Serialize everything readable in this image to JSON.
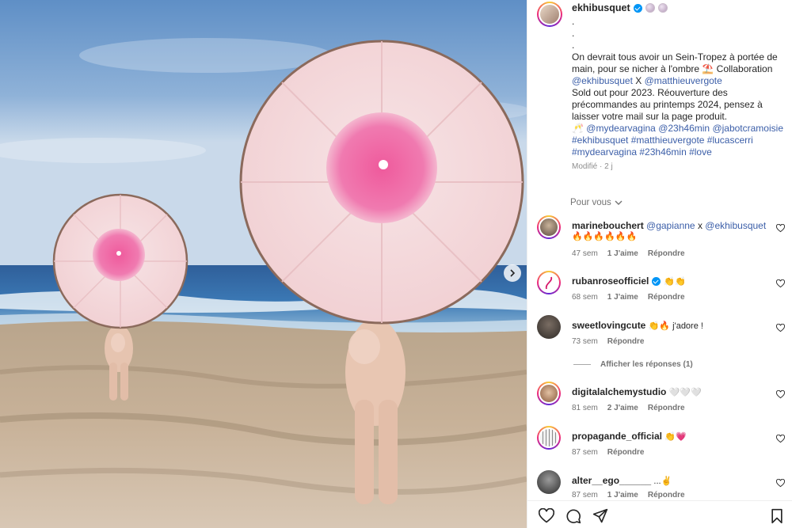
{
  "author": {
    "username": "ekhibusquet"
  },
  "caption": {
    "dots": [
      ".",
      ".",
      "."
    ],
    "line1": "On devrait tous avoir un Sein-Tropez à portée de main, pour se nicher à l'ombre",
    "emoji_umbrella": "⛱️",
    "line1b": " Collaboration",
    "mention1": "@ekhibusquet",
    "x": " X ",
    "mention2": "@matthieuvergote",
    "line2": "Sold out pour 2023. Réouverture des précommandes au printemps 2024, pensez à laisser votre mail sur la page produit.",
    "emoji_champagne": "🥂",
    "mention3": "@mydearvagina",
    "mention4": "@23h46min",
    "mention5": "@jabotcramoisie",
    "hashtags": "#ekhibusquet #matthieuvergote #lucascerri #mydearvagina #23h46min #love",
    "edited": "Modifié · 2 j"
  },
  "pour_vous": "Pour vous",
  "comments": [
    {
      "user": "marinebouchert",
      "mention_a": "@gapianne",
      "mid": " x ",
      "mention_b": "@ekhibusquet",
      "text2": "🔥🔥🔥🔥🔥🔥",
      "time": "47 sem",
      "likes": "1 J'aime",
      "reply": "Répondre"
    },
    {
      "user": "rubanroseofficiel",
      "text": "👏👏",
      "time": "68 sem",
      "likes": "1 J'aime",
      "reply": "Répondre"
    },
    {
      "user": "sweetlovingcute",
      "text": "👏🔥 j'adore !",
      "time": "73 sem",
      "reply": "Répondre"
    },
    {
      "user": "digitalalchemystudio",
      "text": "🤍🤍🤍",
      "time": "81 sem",
      "likes": "2 J'aime",
      "reply": "Répondre"
    },
    {
      "user": "propagande_official",
      "text": "👏💗",
      "time": "87 sem",
      "reply": "Répondre"
    },
    {
      "user": "alter__ego______",
      "text": "...✌️",
      "time": "87 sem",
      "likes": "1 J'aime",
      "reply": "Répondre"
    }
  ],
  "view_replies": "Afficher les réponses (1)",
  "colors": {
    "link": "#3b5ea8",
    "verified": "#0095f6",
    "muted": "#737373"
  },
  "icons": [
    "heart-icon",
    "comment-icon",
    "share-icon",
    "bookmark-icon",
    "chevron-right-icon",
    "chevron-down-icon",
    "verified-icon"
  ]
}
